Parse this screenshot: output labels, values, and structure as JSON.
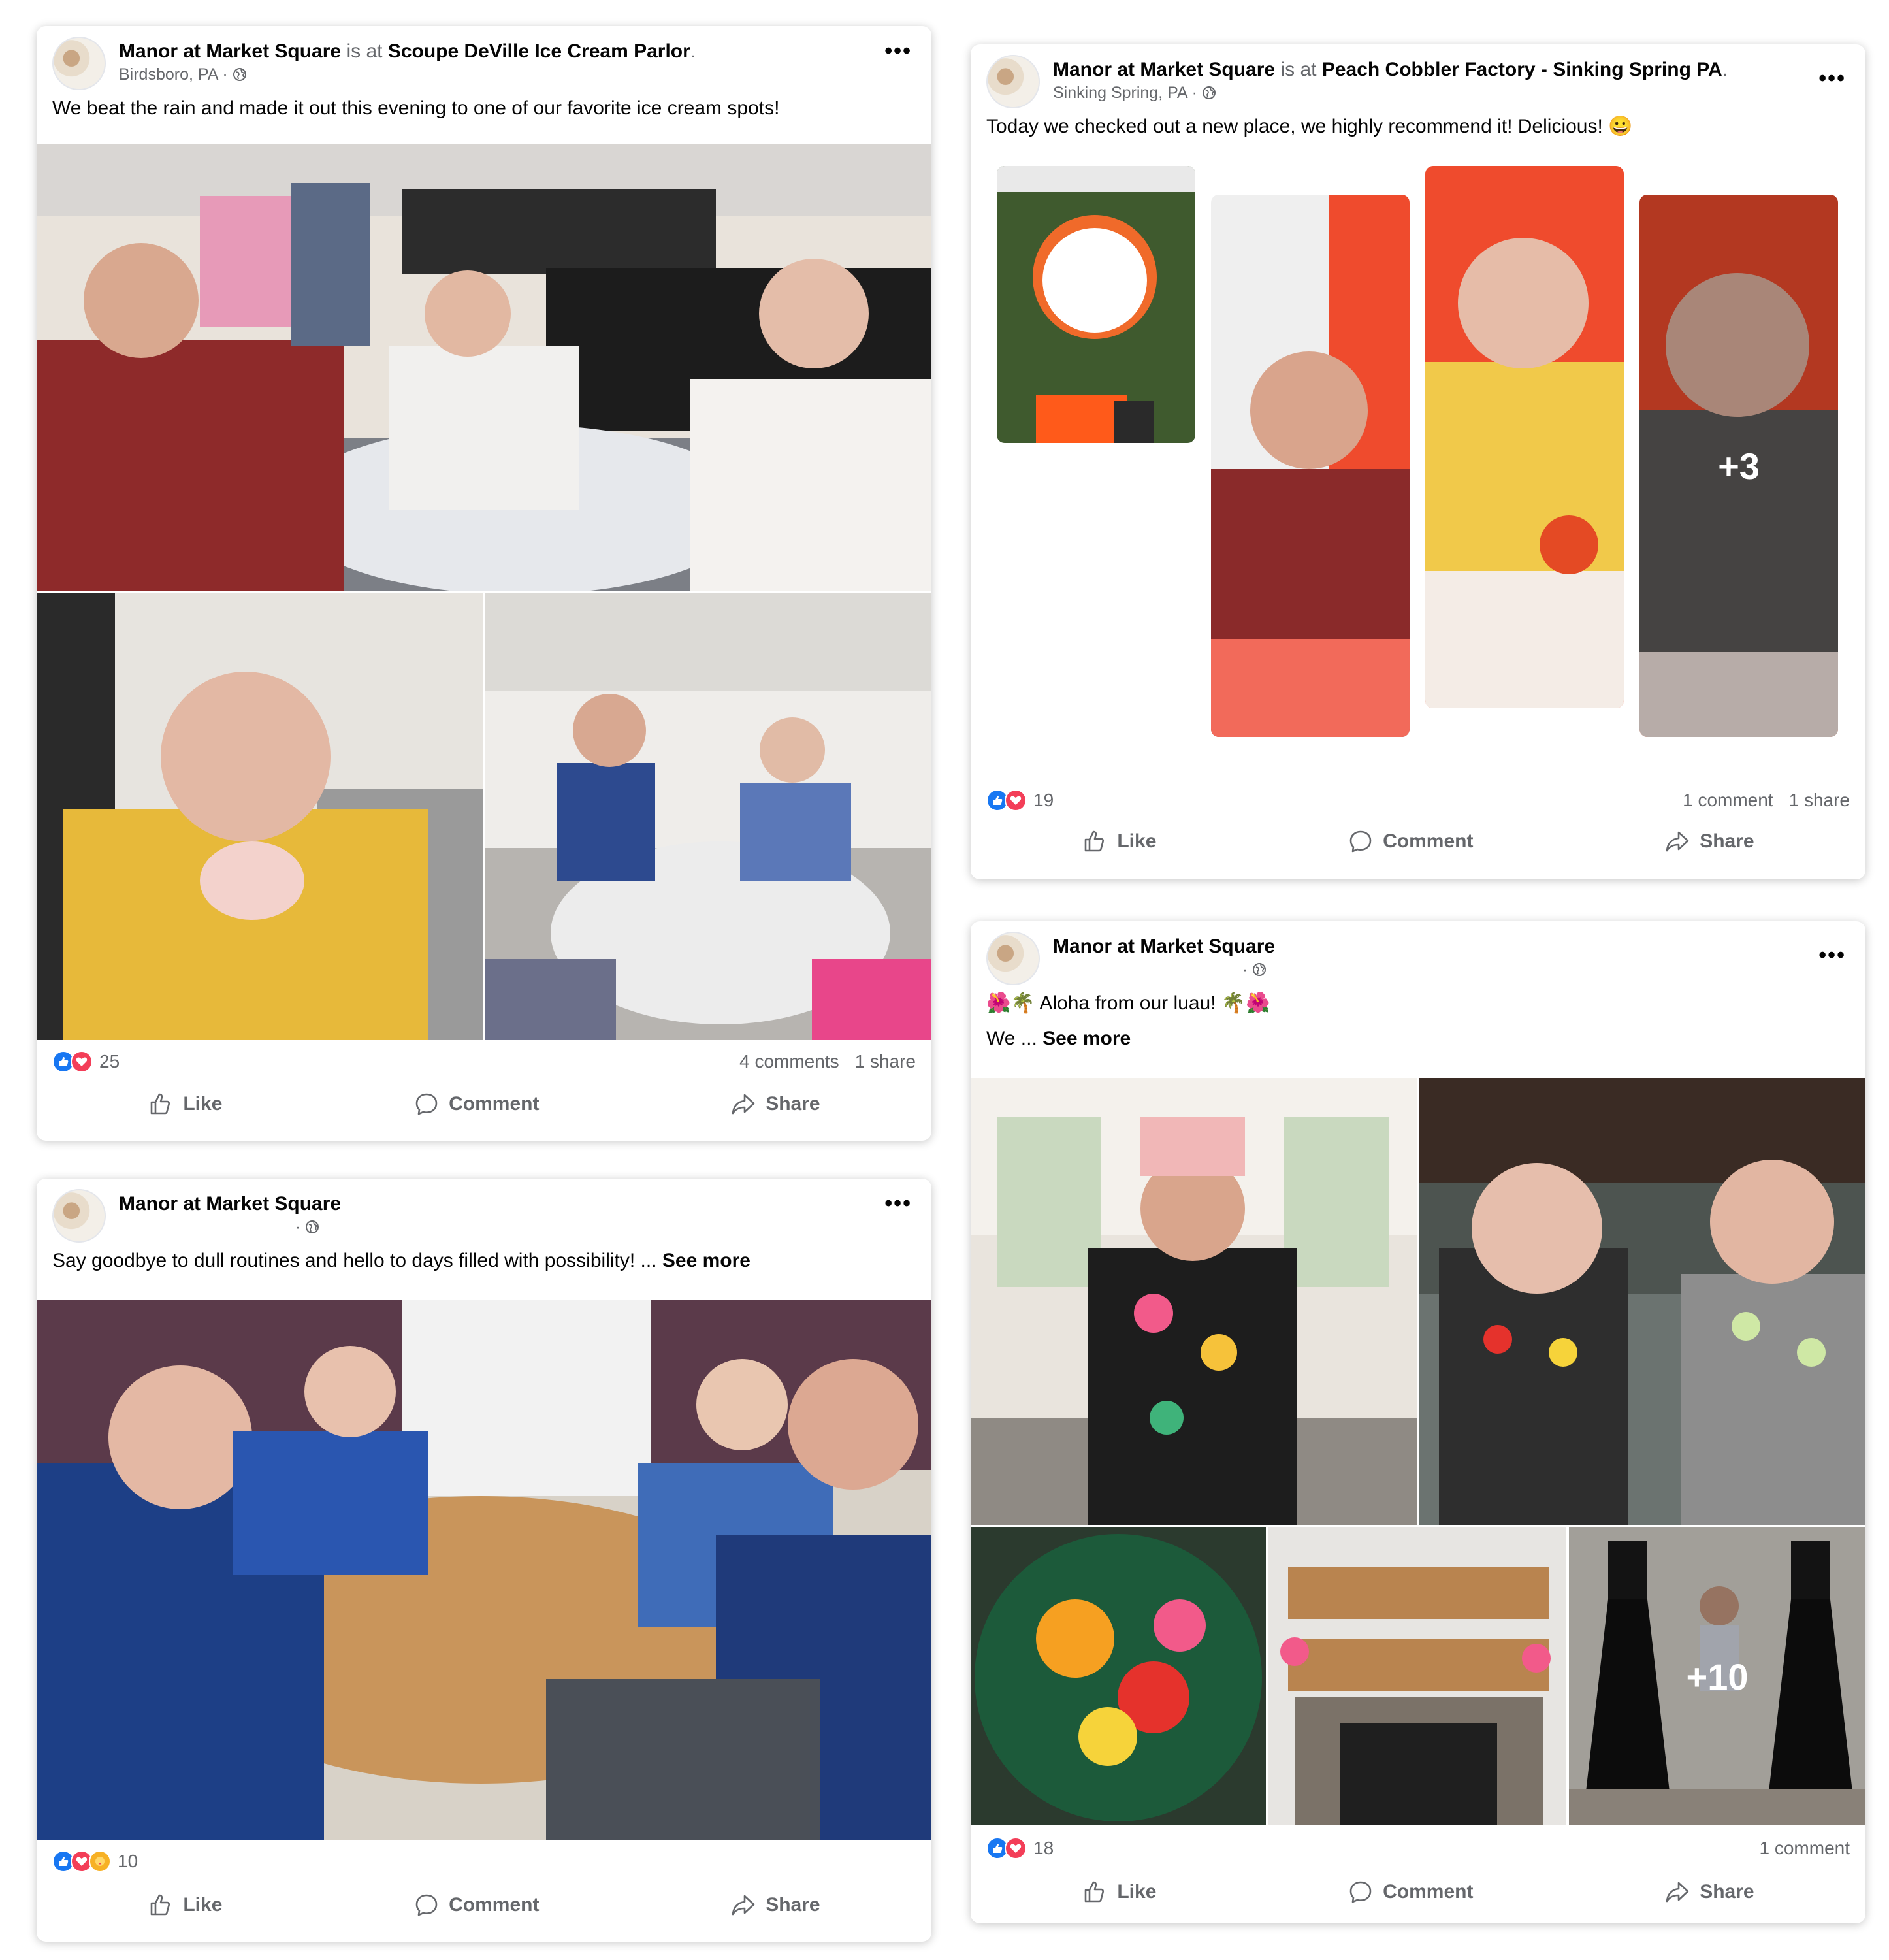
{
  "posts": [
    {
      "author": "Manor at Market Square",
      "connector": "is at",
      "place": "Scoupe DeVille Ice Cream Parlor",
      "location": "Birdsboro, PA",
      "text": "We beat the rain and made it out this evening to one of our favorite ice cream spots!",
      "reaction_count": "25",
      "comments": "4 comments",
      "shares": "1 share"
    },
    {
      "author": "Manor at Market Square",
      "connector": "is at",
      "place": "Peach Cobbler Factory - Sinking Spring PA",
      "location": "Sinking Spring, PA",
      "text": "Today we checked out a new place, we highly recommend it! Delicious! 😀",
      "photo_overlay": "+3",
      "reaction_count": "19",
      "comments": "1 comment",
      "shares": "1 share"
    },
    {
      "author": "Manor at Market Square",
      "text": "Say goodbye to dull routines and hello to days filled with possibility! ...",
      "see_more": "See more",
      "reaction_count": "10"
    },
    {
      "author": "Manor at Market Square",
      "text_line1": "🌺🌴 Aloha from our luau! 🌴🌺",
      "text_line2": "We ...",
      "see_more": "See more",
      "photo_overlay": "+10",
      "reaction_count": "18",
      "comments": "1 comment"
    }
  ],
  "actions": {
    "like": "Like",
    "comment": "Comment",
    "share": "Share"
  },
  "icons": {
    "more": "more-options-icon",
    "globe": "globe-icon",
    "like": "thumbs-up-icon",
    "comment": "comment-bubble-icon",
    "share": "share-arrow-icon"
  },
  "colors": {
    "like_blue": "#1877f2",
    "love_red": "#f33e58",
    "care_yellow": "#f7b125",
    "muted_text": "#65676b"
  }
}
